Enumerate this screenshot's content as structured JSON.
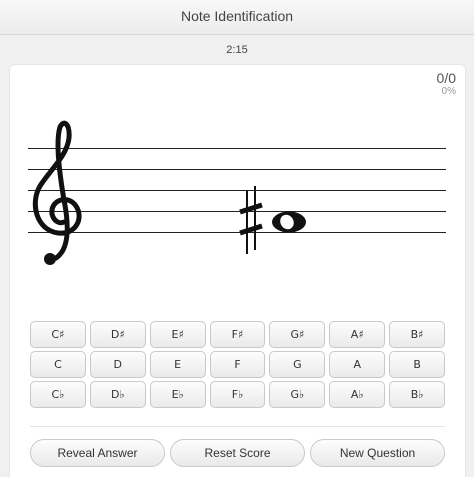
{
  "window": {
    "title": "Note Identification"
  },
  "timer": "2:15",
  "score": {
    "value": "0/0",
    "percent": "0%"
  },
  "staff": {
    "clef": "treble-clef-icon",
    "accidental": "♯",
    "note": "whole-note"
  },
  "answers": [
    [
      "C♯",
      "D♯",
      "E♯",
      "F♯",
      "G♯",
      "A♯",
      "B♯"
    ],
    [
      "C",
      "D",
      "E",
      "F",
      "G",
      "A",
      "B"
    ],
    [
      "C♭",
      "D♭",
      "E♭",
      "F♭",
      "G♭",
      "A♭",
      "B♭"
    ]
  ],
  "actions": {
    "reveal": "Reveal Answer",
    "reset": "Reset Score",
    "new": "New Question"
  }
}
